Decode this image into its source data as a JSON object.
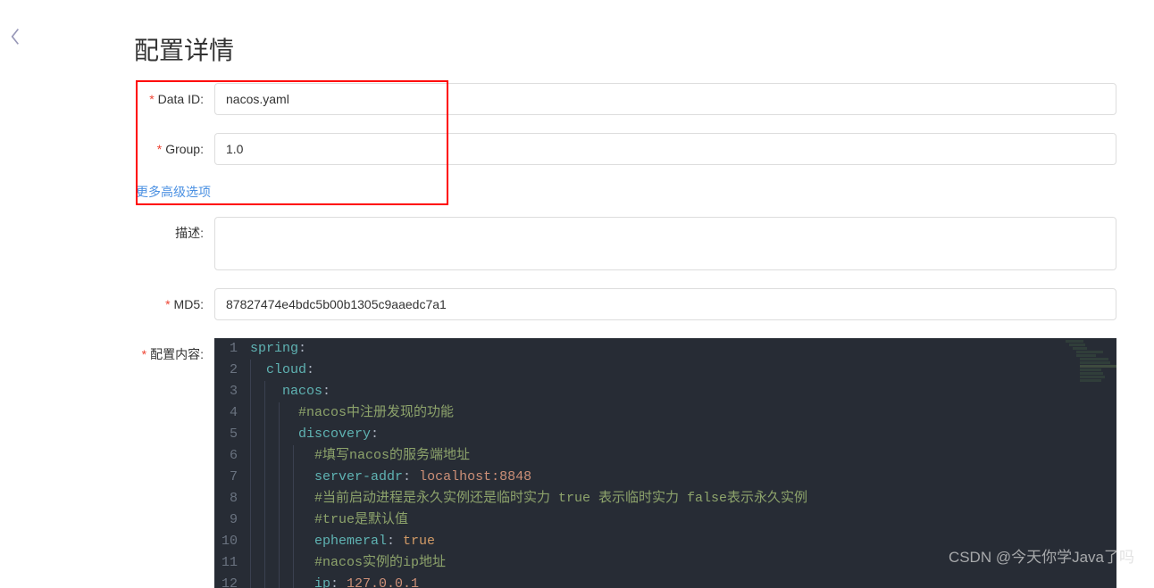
{
  "page_title": "配置详情",
  "labels": {
    "data_id": "Data ID:",
    "group": "Group:",
    "description": "描述:",
    "md5": "MD5:",
    "config_content": "配置内容:"
  },
  "values": {
    "data_id": "nacos.yaml",
    "group": "1.0",
    "description": "",
    "md5": "87827474e4bdc5b00b1305c9aaedc7a1"
  },
  "more_options": "更多高级选项",
  "code_lines": [
    {
      "n": 1,
      "indent": 0,
      "tokens": [
        {
          "t": "spring",
          "c": "key"
        },
        {
          "t": ":",
          "c": "colon"
        }
      ]
    },
    {
      "n": 2,
      "indent": 1,
      "tokens": [
        {
          "t": "cloud",
          "c": "key"
        },
        {
          "t": ":",
          "c": "colon"
        }
      ]
    },
    {
      "n": 3,
      "indent": 2,
      "tokens": [
        {
          "t": "nacos",
          "c": "key"
        },
        {
          "t": ":",
          "c": "colon"
        }
      ]
    },
    {
      "n": 4,
      "indent": 3,
      "tokens": [
        {
          "t": "#nacos中注册发现的功能",
          "c": "comment"
        }
      ]
    },
    {
      "n": 5,
      "indent": 3,
      "tokens": [
        {
          "t": "discovery",
          "c": "key"
        },
        {
          "t": ":",
          "c": "colon"
        }
      ]
    },
    {
      "n": 6,
      "indent": 4,
      "tokens": [
        {
          "t": "#填写nacos的服务端地址",
          "c": "comment"
        }
      ]
    },
    {
      "n": 7,
      "indent": 4,
      "tokens": [
        {
          "t": "server-addr",
          "c": "key"
        },
        {
          "t": ": ",
          "c": "colon"
        },
        {
          "t": "localhost:8848",
          "c": "string"
        }
      ]
    },
    {
      "n": 8,
      "indent": 4,
      "tokens": [
        {
          "t": "#当前启动进程是永久实例还是临时实力 true 表示临时实力 false表示永久实例",
          "c": "comment"
        }
      ]
    },
    {
      "n": 9,
      "indent": 4,
      "tokens": [
        {
          "t": "#true是默认值",
          "c": "comment"
        }
      ]
    },
    {
      "n": 10,
      "indent": 4,
      "tokens": [
        {
          "t": "ephemeral",
          "c": "key"
        },
        {
          "t": ": ",
          "c": "colon"
        },
        {
          "t": "true",
          "c": "bool"
        }
      ]
    },
    {
      "n": 11,
      "indent": 4,
      "tokens": [
        {
          "t": "#nacos实例的ip地址",
          "c": "comment"
        }
      ]
    },
    {
      "n": 12,
      "indent": 4,
      "tokens": [
        {
          "t": "ip",
          "c": "key"
        },
        {
          "t": ": ",
          "c": "colon"
        },
        {
          "t": "127.0.0.1",
          "c": "string"
        }
      ]
    }
  ],
  "watermark": "CSDN @今天你学Java了吗"
}
